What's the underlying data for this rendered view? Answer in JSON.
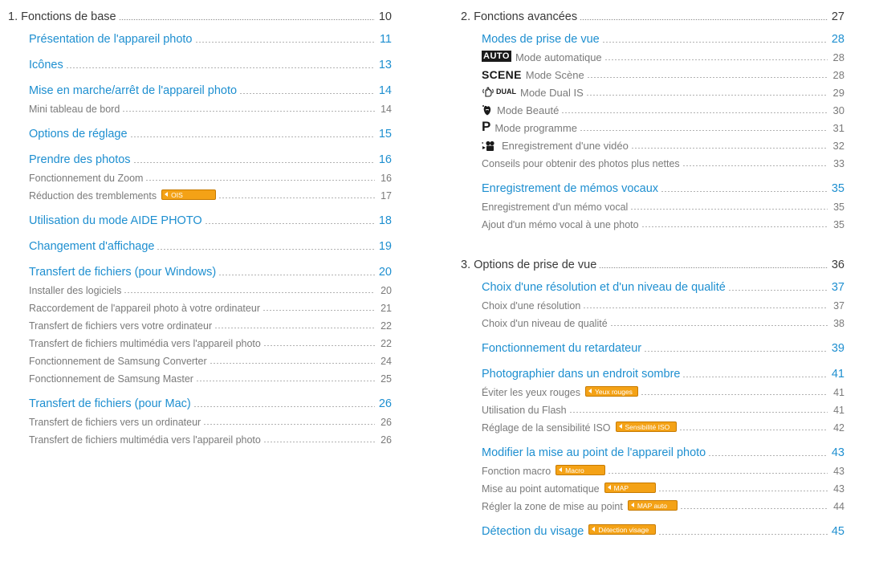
{
  "sections": [
    {
      "title": "1. Fonctions de base",
      "page": "10",
      "items": [
        {
          "kind": "sub",
          "label": "Présentation de l'appareil photo",
          "page": "11"
        },
        {
          "kind": "sub",
          "label": "Icônes",
          "page": "13"
        },
        {
          "kind": "sub",
          "label": "Mise en marche/arrêt de l'appareil photo",
          "page": "14"
        },
        {
          "kind": "entry",
          "label": "Mini tableau de bord",
          "page": "14"
        },
        {
          "kind": "sub",
          "label": "Options de réglage",
          "page": "15"
        },
        {
          "kind": "sub",
          "label": "Prendre des photos",
          "page": "16"
        },
        {
          "kind": "entry",
          "label": "Fonctionnement du Zoom",
          "page": "16"
        },
        {
          "kind": "entry",
          "label": "Réduction des tremblements",
          "badge": "OIS",
          "page": "17"
        },
        {
          "kind": "sub",
          "label": "Utilisation du mode AIDE PHOTO",
          "page": "18"
        },
        {
          "kind": "sub",
          "label": "Changement d'affichage",
          "page": "19"
        },
        {
          "kind": "sub",
          "label": "Transfert de fichiers (pour Windows)",
          "page": "20"
        },
        {
          "kind": "entry",
          "label": "Installer des logiciels",
          "page": "20"
        },
        {
          "kind": "entry",
          "label": "Raccordement de l'appareil photo à votre ordinateur",
          "page": "21"
        },
        {
          "kind": "entry",
          "label": "Transfert de fichiers vers votre ordinateur",
          "page": "22"
        },
        {
          "kind": "entry",
          "label": "Transfert de fichiers multimédia vers l'appareil photo",
          "page": "22"
        },
        {
          "kind": "entry",
          "label": "Fonctionnement de Samsung Converter",
          "page": "24"
        },
        {
          "kind": "entry",
          "label": "Fonctionnement de Samsung Master",
          "page": "25"
        },
        {
          "kind": "sub",
          "label": "Transfert de fichiers (pour Mac)",
          "page": "26"
        },
        {
          "kind": "entry",
          "label": "Transfert de fichiers vers un ordinateur",
          "page": "26"
        },
        {
          "kind": "entry",
          "label": "Transfert de fichiers multimédia vers l'appareil photo",
          "page": "26"
        }
      ]
    },
    {
      "title": "2. Fonctions avancées",
      "page": "27",
      "items": [
        {
          "kind": "sub",
          "label": "Modes de prise de vue",
          "page": "28"
        },
        {
          "kind": "entry",
          "icon": "auto",
          "icon_text": "AUTO",
          "label": "Mode automatique",
          "page": "28"
        },
        {
          "kind": "entry",
          "icon": "scene",
          "icon_text": "SCENE",
          "label": "Mode Scène",
          "page": "28"
        },
        {
          "kind": "entry",
          "icon": "dual",
          "icon_text": "DUAL",
          "label": "Mode Dual IS",
          "page": "29"
        },
        {
          "kind": "entry",
          "icon": "beauty",
          "label": "Mode Beauté",
          "page": "30"
        },
        {
          "kind": "entry",
          "icon": "program",
          "icon_text": "P",
          "label": "Mode programme",
          "page": "31"
        },
        {
          "kind": "entry",
          "icon": "movie",
          "label": "Enregistrement d'une vidéo",
          "page": "32"
        },
        {
          "kind": "entry",
          "label": "Conseils pour obtenir des photos plus nettes",
          "page": "33"
        },
        {
          "kind": "sub",
          "label": "Enregistrement de mémos vocaux",
          "page": "35"
        },
        {
          "kind": "entry",
          "label": "Enregistrement d'un mémo vocal",
          "page": "35"
        },
        {
          "kind": "entry",
          "label": "Ajout d'un mémo vocal à une photo",
          "page": "35"
        }
      ]
    },
    {
      "title": "3. Options de prise de vue",
      "page": "36",
      "items": [
        {
          "kind": "sub",
          "label": "Choix d'une résolution et d'un niveau de qualité",
          "page": "37"
        },
        {
          "kind": "entry",
          "label": "Choix d'une résolution",
          "page": "37"
        },
        {
          "kind": "entry",
          "label": "Choix d'un niveau de qualité",
          "page": "38"
        },
        {
          "kind": "sub",
          "label": "Fonctionnement du retardateur",
          "page": "39"
        },
        {
          "kind": "sub",
          "label": "Photographier dans un endroit sombre",
          "page": "41"
        },
        {
          "kind": "entry",
          "label": "Éviter les yeux rouges",
          "badge": "Yeux rouges",
          "page": "41"
        },
        {
          "kind": "entry",
          "label": "Utilisation du Flash",
          "page": "41"
        },
        {
          "kind": "entry",
          "label": "Réglage de la sensibilité ISO",
          "badge": "Sensibilité ISO",
          "page": "42"
        },
        {
          "kind": "sub",
          "label": "Modifier la mise au point de l'appareil photo",
          "page": "43"
        },
        {
          "kind": "entry",
          "label": "Fonction macro",
          "badge": "Macro",
          "page": "43"
        },
        {
          "kind": "entry",
          "label": "Mise au point automatique",
          "badge": "MAP",
          "page": "43"
        },
        {
          "kind": "entry",
          "label": "Régler la zone de mise au point",
          "badge": "MAP auto",
          "page": "44"
        },
        {
          "kind": "sub",
          "label": "Détection du visage",
          "badge": "Détection visage",
          "page": "45"
        }
      ]
    }
  ],
  "colors": {
    "subheading": "#1e8fd0",
    "entry": "#7a7a7a",
    "badge": "#f4a216"
  }
}
